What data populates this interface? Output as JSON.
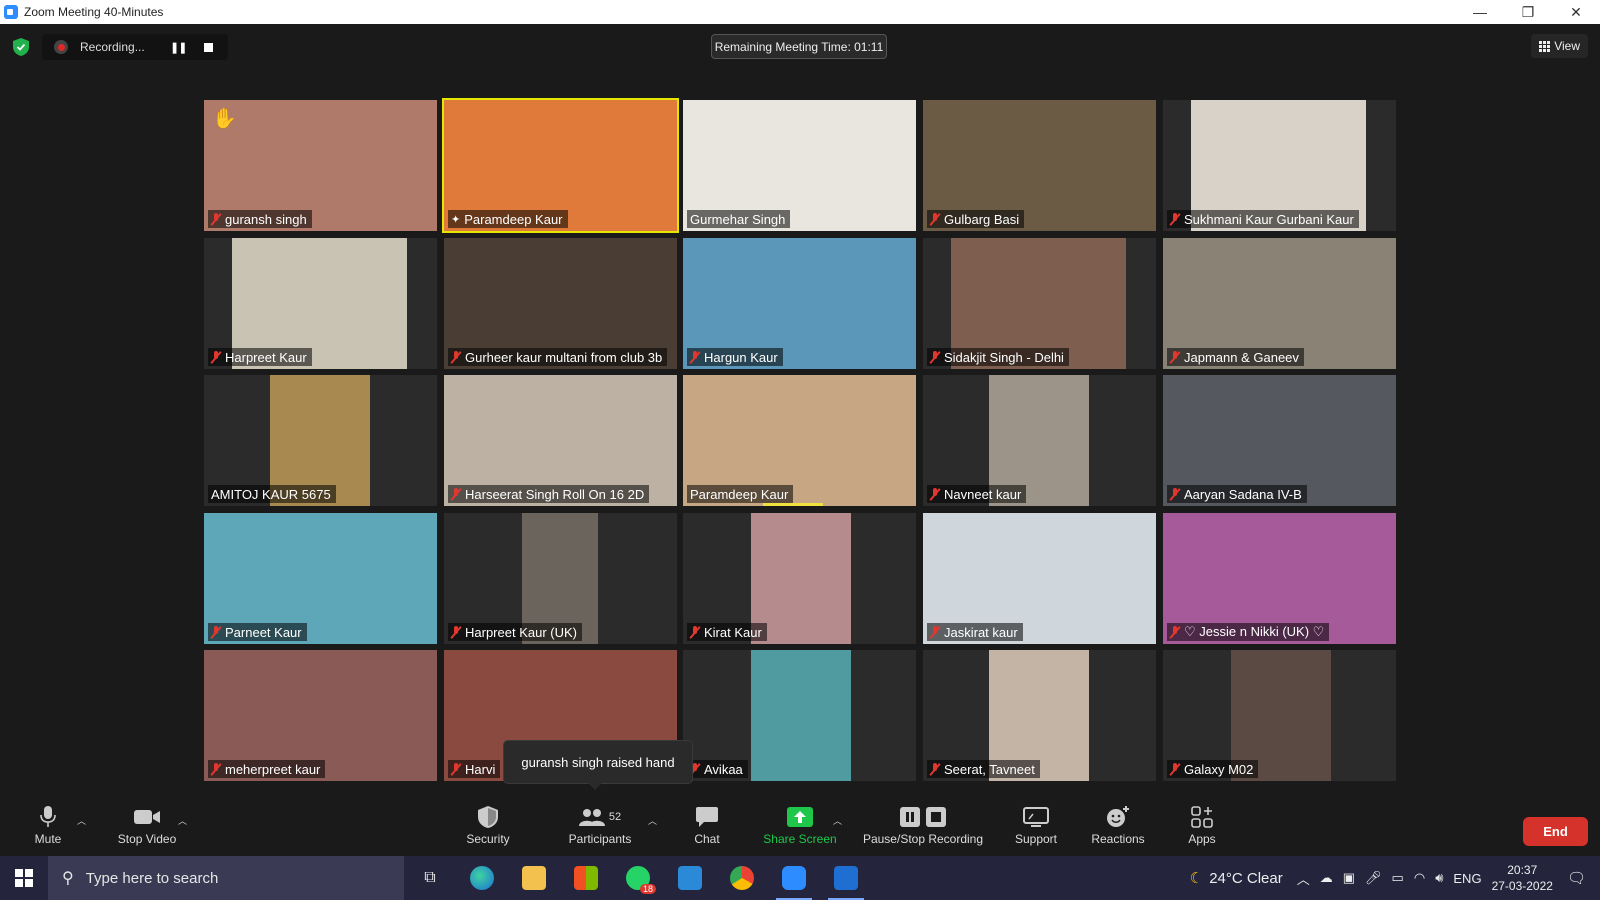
{
  "window": {
    "title": "Zoom Meeting 40-Minutes",
    "minimize": "—",
    "restore": "❐",
    "close": "✕"
  },
  "recording": {
    "label": "Recording...",
    "pause_glyph": "❚❚"
  },
  "meeting": {
    "remaining_time": "Remaining Meeting Time: 01:11"
  },
  "view_button": {
    "label": "View"
  },
  "participants": [
    {
      "name": "guransh singh",
      "muted": true,
      "hand_raised": true,
      "bg": "#b07a6a"
    },
    {
      "name": "Paramdeep Kaur",
      "muted": false,
      "pinned": true,
      "active": true,
      "bg": "#e07a3a"
    },
    {
      "name": "Gurmehar Singh",
      "muted": false,
      "bg": "#e9e6df"
    },
    {
      "name": "Gulbarg Basi",
      "muted": true,
      "bg": "#6b5b45"
    },
    {
      "name": "Sukhmani Kaur Gurbani Kaur",
      "muted": true,
      "bg": "#d9d2c8"
    },
    {
      "name": "Harpreet Kaur",
      "muted": true,
      "bg": "#c9c3b3"
    },
    {
      "name": "Gurheer kaur multani from club 3b",
      "muted": true,
      "bg": "#4a3e34"
    },
    {
      "name": "Hargun Kaur",
      "muted": true,
      "bg": "#5a97b8"
    },
    {
      "name": "Sidakjit Singh - Delhi",
      "muted": true,
      "bg": "#7d5e4f"
    },
    {
      "name": "Japmann & Ganeev",
      "muted": true,
      "bg": "#8a8275"
    },
    {
      "name": "AMITOJ KAUR 5675",
      "muted": false,
      "bg": "#a8894f"
    },
    {
      "name": "Harseerat Singh Roll On 16 2D",
      "muted": true,
      "bg": "#bdb1a4"
    },
    {
      "name": "Paramdeep Kaur",
      "muted": false,
      "bg": "#c7a783"
    },
    {
      "name": "Navneet kaur",
      "muted": true,
      "bg": "#9c9488"
    },
    {
      "name": "Aaryan Sadana IV-B",
      "muted": true,
      "bg": "#55585e"
    },
    {
      "name": "Parneet Kaur",
      "muted": true,
      "bg": "#5ea7b8"
    },
    {
      "name": "Harpreet Kaur (UK)",
      "muted": true,
      "bg": "#6a645c"
    },
    {
      "name": "Kirat Kaur",
      "muted": true,
      "bg": "#b68b8e"
    },
    {
      "name": "Jaskirat kaur",
      "muted": true,
      "bg": "#cfd6dc"
    },
    {
      "name": "♡ Jessie n Nikki (UK) ♡",
      "muted": true,
      "bg": "#a65a9a"
    },
    {
      "name": "meherpreet kaur",
      "muted": true,
      "bg": "#8a5a56"
    },
    {
      "name": "Harvi",
      "muted": true,
      "bg": "#8a4a40"
    },
    {
      "name": "Avikaa",
      "muted": true,
      "bg": "#4f9ba0"
    },
    {
      "name": "Seerat, Tavneet",
      "muted": true,
      "bg": "#c4b4a6"
    },
    {
      "name": "Galaxy M02",
      "muted": true,
      "bg": "#5b4a44"
    }
  ],
  "notification": {
    "text": "guransh singh raised hand"
  },
  "toolbar": {
    "mute": "Mute",
    "stop_video": "Stop Video",
    "security": "Security",
    "participants": "Participants",
    "participants_count": "52",
    "chat": "Chat",
    "share_screen": "Share Screen",
    "pause_stop_recording": "Pause/Stop Recording",
    "support": "Support",
    "reactions": "Reactions",
    "apps": "Apps",
    "end": "End",
    "share_color": "#1ec74a",
    "end_color": "#d6322c"
  },
  "taskbar": {
    "search_placeholder": "Type here to search",
    "whatsapp_badge": "18",
    "weather": "24°C  Clear",
    "language": "ENG",
    "time": "20:37",
    "date": "27-03-2022"
  }
}
